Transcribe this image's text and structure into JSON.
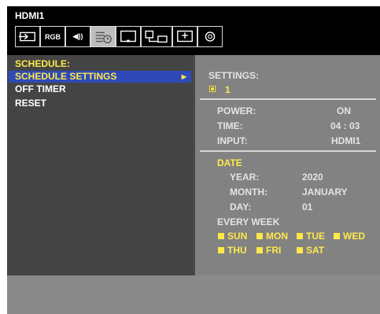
{
  "header": {
    "title": "HDMI1"
  },
  "tabs": [
    {
      "icon": "input-icon"
    },
    {
      "icon": "picture-icon",
      "label": "RGB"
    },
    {
      "icon": "audio-icon",
      "label": "◀))"
    },
    {
      "icon": "schedule-icon",
      "active": true
    },
    {
      "icon": "monitor-icon"
    },
    {
      "icon": "network-icon"
    },
    {
      "icon": "protect-icon"
    },
    {
      "icon": "system-icon"
    }
  ],
  "menu": {
    "heading": "SCHEDULE:",
    "items": [
      "SCHEDULE SETTINGS",
      "OFF TIMER",
      "RESET"
    ],
    "selected_arrow": "▶"
  },
  "panel": {
    "settings_label": "SETTINGS:",
    "settings_value": "1",
    "power_label": "POWER:",
    "power_value": "ON",
    "time_label": "TIME:",
    "time_value": "04 : 03",
    "input_label": "INPUT:",
    "input_value": "HDMI1",
    "date_heading": "DATE",
    "year_label": "YEAR:",
    "year_value": "2020",
    "month_label": "MONTH:",
    "month_value": "JANUARY",
    "day_label": "DAY:",
    "day_value": "01",
    "every_week": "EVERY WEEK",
    "days": [
      "SUN",
      "MON",
      "TUE",
      "WED",
      "THU",
      "FRI",
      "SAT"
    ]
  },
  "colors": {
    "accent_yellow": "#ffe94a",
    "selection_blue": "#2f4ab8"
  }
}
